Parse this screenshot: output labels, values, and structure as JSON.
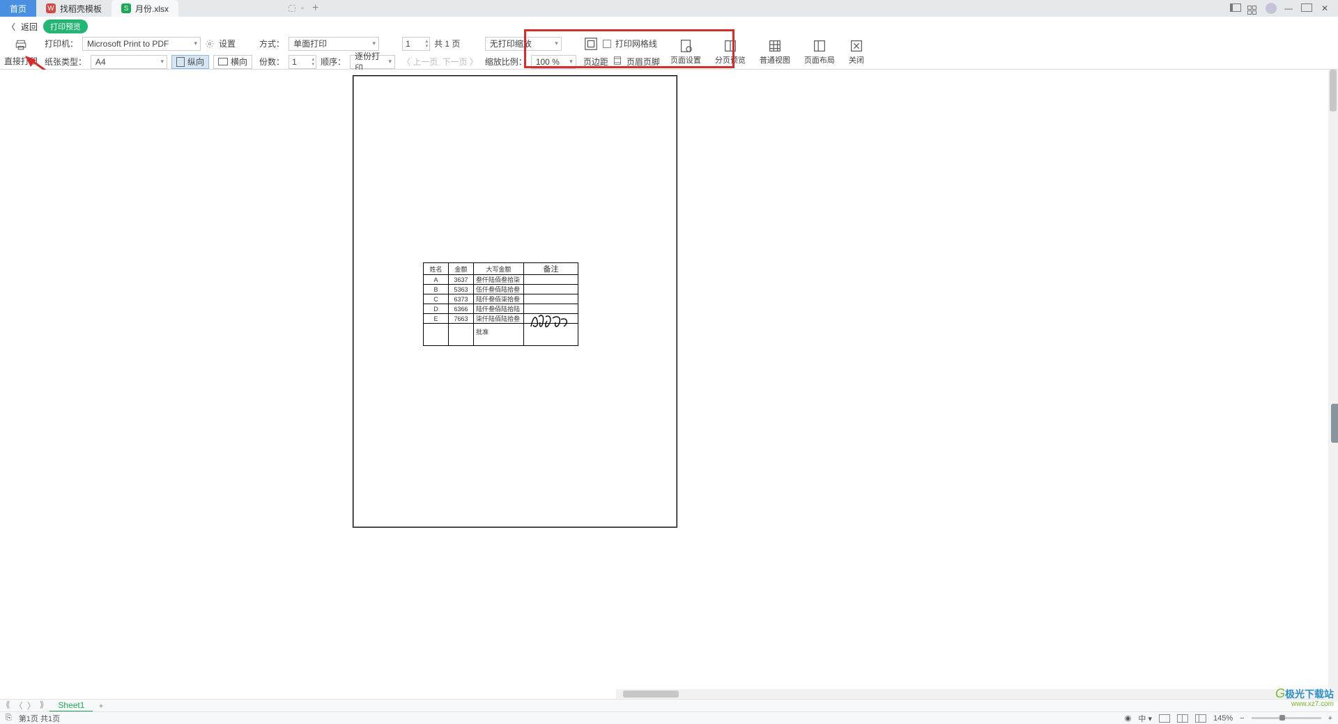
{
  "tabs": {
    "home": "首页",
    "template": "找稻壳模板",
    "file": "月份.xlsx"
  },
  "backrow": {
    "back": "返回",
    "badge": "打印预览"
  },
  "toolbar": {
    "direct_print": "直接打印",
    "printer_label": "打印机：",
    "printer_value": "Microsoft Print to PDF",
    "paper_label": "纸张类型：",
    "paper_value": "A4",
    "settings": "设置",
    "portrait": "纵向",
    "landscape": "横向",
    "mode_label": "方式：",
    "mode_value": "单面打印",
    "copies_label": "份数：",
    "copies_value": "1",
    "order_label": "顺序：",
    "order_value": "逐份打印",
    "page_value": "1",
    "page_total": "共 1 页",
    "prev": "上一页",
    "next": "下一页",
    "scale_sel": "无打印缩放",
    "scale_label": "缩放比例：",
    "scale_value": "100 %",
    "gridlines": "打印网格线",
    "margins": "页边距",
    "header_footer": "页眉页脚",
    "page_setup": "页面设置",
    "page_break": "分页预览",
    "normal_view": "普通视图",
    "page_layout": "页面布局",
    "close": "关闭"
  },
  "table": {
    "headers": [
      "姓名",
      "金额",
      "大写金额",
      "备注"
    ],
    "rows": [
      [
        "A",
        "3637",
        "叁仟陆佰叁拾柒"
      ],
      [
        "B",
        "5363",
        "伍仟叁佰陆拾叁"
      ],
      [
        "C",
        "6373",
        "陆仟叁佰柒拾叁"
      ],
      [
        "D",
        "6366",
        "陆仟叁佰陆拾陆"
      ],
      [
        "E",
        "7663",
        "柒仟陆佰陆拾叁"
      ]
    ],
    "approval": "批准"
  },
  "sheets": {
    "sheet1": "Sheet1"
  },
  "status": {
    "page": "第1页 共1页",
    "zoom": "145%"
  },
  "watermark": {
    "name": "极光下载站",
    "url": "www.xz7.com"
  }
}
